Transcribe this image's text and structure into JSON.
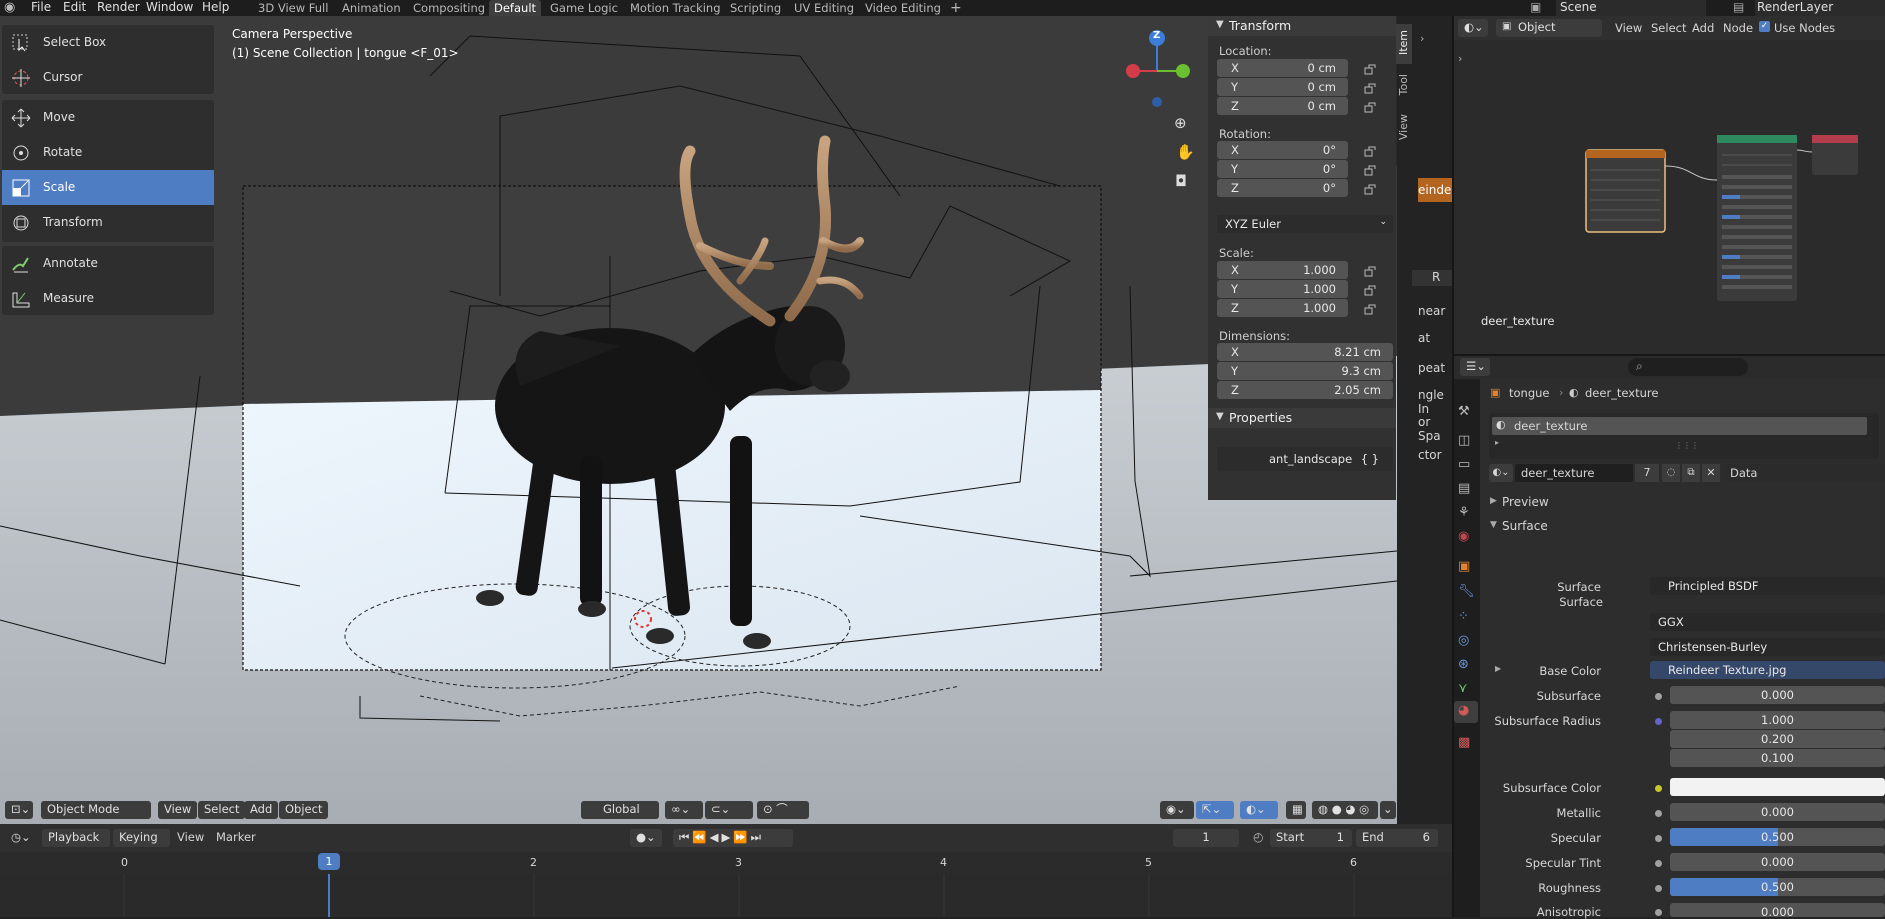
{
  "menubar": {
    "items": [
      "File",
      "Edit",
      "Render",
      "Window",
      "Help"
    ],
    "workspaces": [
      "3D View Full",
      "Animation",
      "Compositing",
      "Default",
      "Game Logic",
      "Motion Tracking",
      "Scripting",
      "UV Editing",
      "Video Editing"
    ],
    "active_workspace": "Default",
    "add_tab": "+",
    "scene_label": "Scene",
    "layer_label": "RenderLayer"
  },
  "toolbar": {
    "select_box": "Select Box",
    "cursor": "Cursor",
    "move": "Move",
    "rotate": "Rotate",
    "scale": "Scale",
    "transform": "Transform",
    "annotate": "Annotate",
    "measure": "Measure"
  },
  "viewport": {
    "perspective": "Camera Perspective",
    "collection": "(1) Scene Collection | tongue <F_01>",
    "gizmo_z": "Z",
    "header": {
      "mode": "Object Mode",
      "view": "View",
      "select": "Select",
      "add": "Add",
      "object": "Object",
      "transform_orientation": "Global"
    }
  },
  "npanel": {
    "tabs": [
      "Item",
      "Tool",
      "View"
    ],
    "transform_title": "Transform",
    "location_label": "Location:",
    "location": [
      {
        "axis": "X",
        "value": "0 cm"
      },
      {
        "axis": "Y",
        "value": "0 cm"
      },
      {
        "axis": "Z",
        "value": "0 cm"
      }
    ],
    "rotation_label": "Rotation:",
    "rotation": [
      {
        "axis": "X",
        "value": "0°"
      },
      {
        "axis": "Y",
        "value": "0°"
      },
      {
        "axis": "Z",
        "value": "0°"
      }
    ],
    "rotation_mode": "XYZ Euler",
    "scale_label": "Scale:",
    "scale": [
      {
        "axis": "X",
        "value": "1.000"
      },
      {
        "axis": "Y",
        "value": "1.000"
      },
      {
        "axis": "Z",
        "value": "1.000"
      }
    ],
    "dimensions_label": "Dimensions:",
    "dimensions": [
      {
        "axis": "X",
        "value": "8.21 cm"
      },
      {
        "axis": "Y",
        "value": "9.3 cm"
      },
      {
        "axis": "Z",
        "value": "2.05 cm"
      }
    ],
    "properties_title": "Properties",
    "property_name": "ant_landscape",
    "property_value": "{ }"
  },
  "partial_panel": {
    "lines": [
      "einde",
      "R",
      "near",
      "at",
      "peat",
      "ngle In",
      "or Spa",
      "ctor"
    ]
  },
  "node_editor": {
    "object_label": "Object",
    "view": "View",
    "select": "Select",
    "add": "Add",
    "node": "Node",
    "use_nodes": "Use Nodes",
    "material_name": "deer_texture"
  },
  "properties": {
    "breadcrumb_object": "tongue",
    "breadcrumb_material": "deer_texture",
    "slot_name": "deer_texture",
    "material_field": "deer_texture",
    "user_count": "7",
    "link_mode": "Data",
    "preview_label": "Preview",
    "surface_label": "Surface",
    "rows": {
      "surface": {
        "label": "Surface",
        "value": "Principled BSDF"
      },
      "distribution": "GGX",
      "subsurface_method": "Christensen-Burley",
      "base_color": {
        "label": "Base Color",
        "value": "Reindeer Texture.jpg"
      },
      "subsurface": {
        "label": "Subsurface",
        "value": "0.000"
      },
      "subsurface_radius": {
        "label": "Subsurface Radius",
        "values": [
          "1.000",
          "0.200",
          "0.100"
        ]
      },
      "subsurface_color": {
        "label": "Subsurface Color"
      },
      "metallic": {
        "label": "Metallic",
        "value": "0.000"
      },
      "specular": {
        "label": "Specular",
        "value": "0.500",
        "fraction": 0.5
      },
      "specular_tint": {
        "label": "Specular Tint",
        "value": "0.000"
      },
      "roughness": {
        "label": "Roughness",
        "value": "0.500",
        "fraction": 0.5
      },
      "anisotropic": {
        "label": "Anisotropic",
        "value": "0.000"
      }
    }
  },
  "timeline": {
    "playback": "Playback",
    "keying": "Keying",
    "view": "View",
    "marker": "Marker",
    "current_frame": "1",
    "start_label": "Start",
    "start_value": "1",
    "end_label": "End",
    "end_value": "6",
    "ruler": [
      "0",
      "1",
      "2",
      "3",
      "4",
      "5",
      "6"
    ]
  },
  "colors": {
    "accent": "#4f7dc4",
    "background": "#232323",
    "panel": "#313131",
    "field": "#545454"
  }
}
